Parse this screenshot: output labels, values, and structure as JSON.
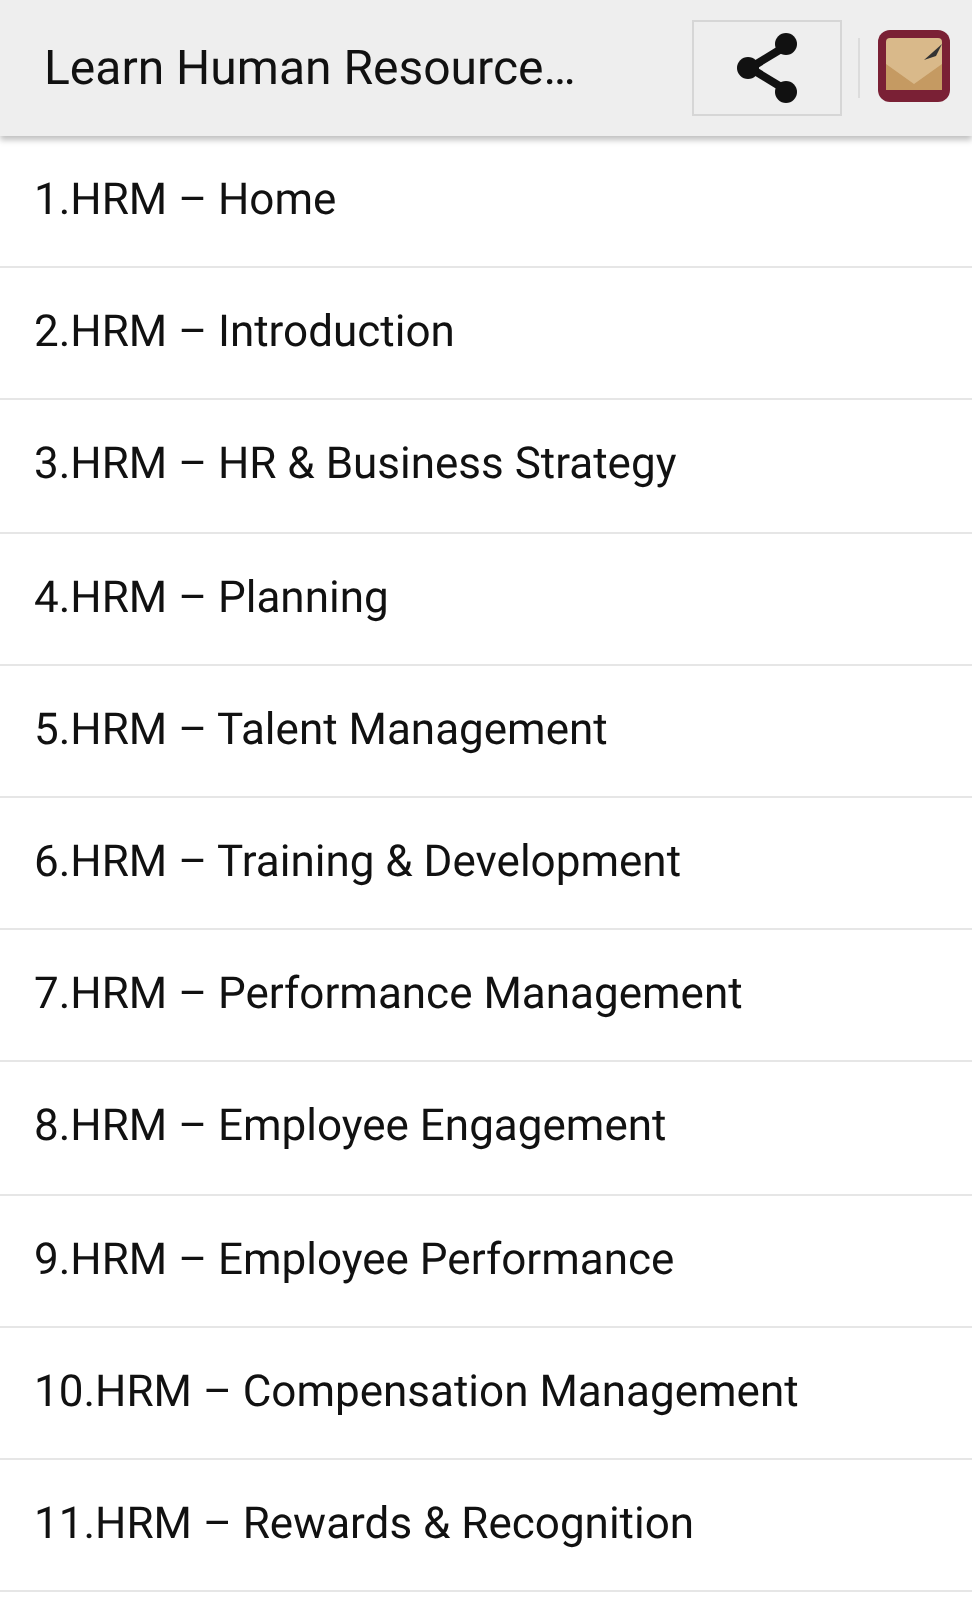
{
  "toolbar": {
    "title": "Learn Human Resource…"
  },
  "items": [
    {
      "label": "1.HRM – Home"
    },
    {
      "label": "2.HRM – Introduction"
    },
    {
      "label": "3.HRM – HR & Business Strategy"
    },
    {
      "label": "4.HRM – Planning"
    },
    {
      "label": "5.HRM – Talent Management"
    },
    {
      "label": "6.HRM – Training & Development"
    },
    {
      "label": "7.HRM – Performance Management"
    },
    {
      "label": "8.HRM – Employee Engagement"
    },
    {
      "label": "9.HRM – Employee Performance"
    },
    {
      "label": "10.HRM – Compensation Management"
    },
    {
      "label": "11.HRM – Rewards & Recognition"
    }
  ]
}
